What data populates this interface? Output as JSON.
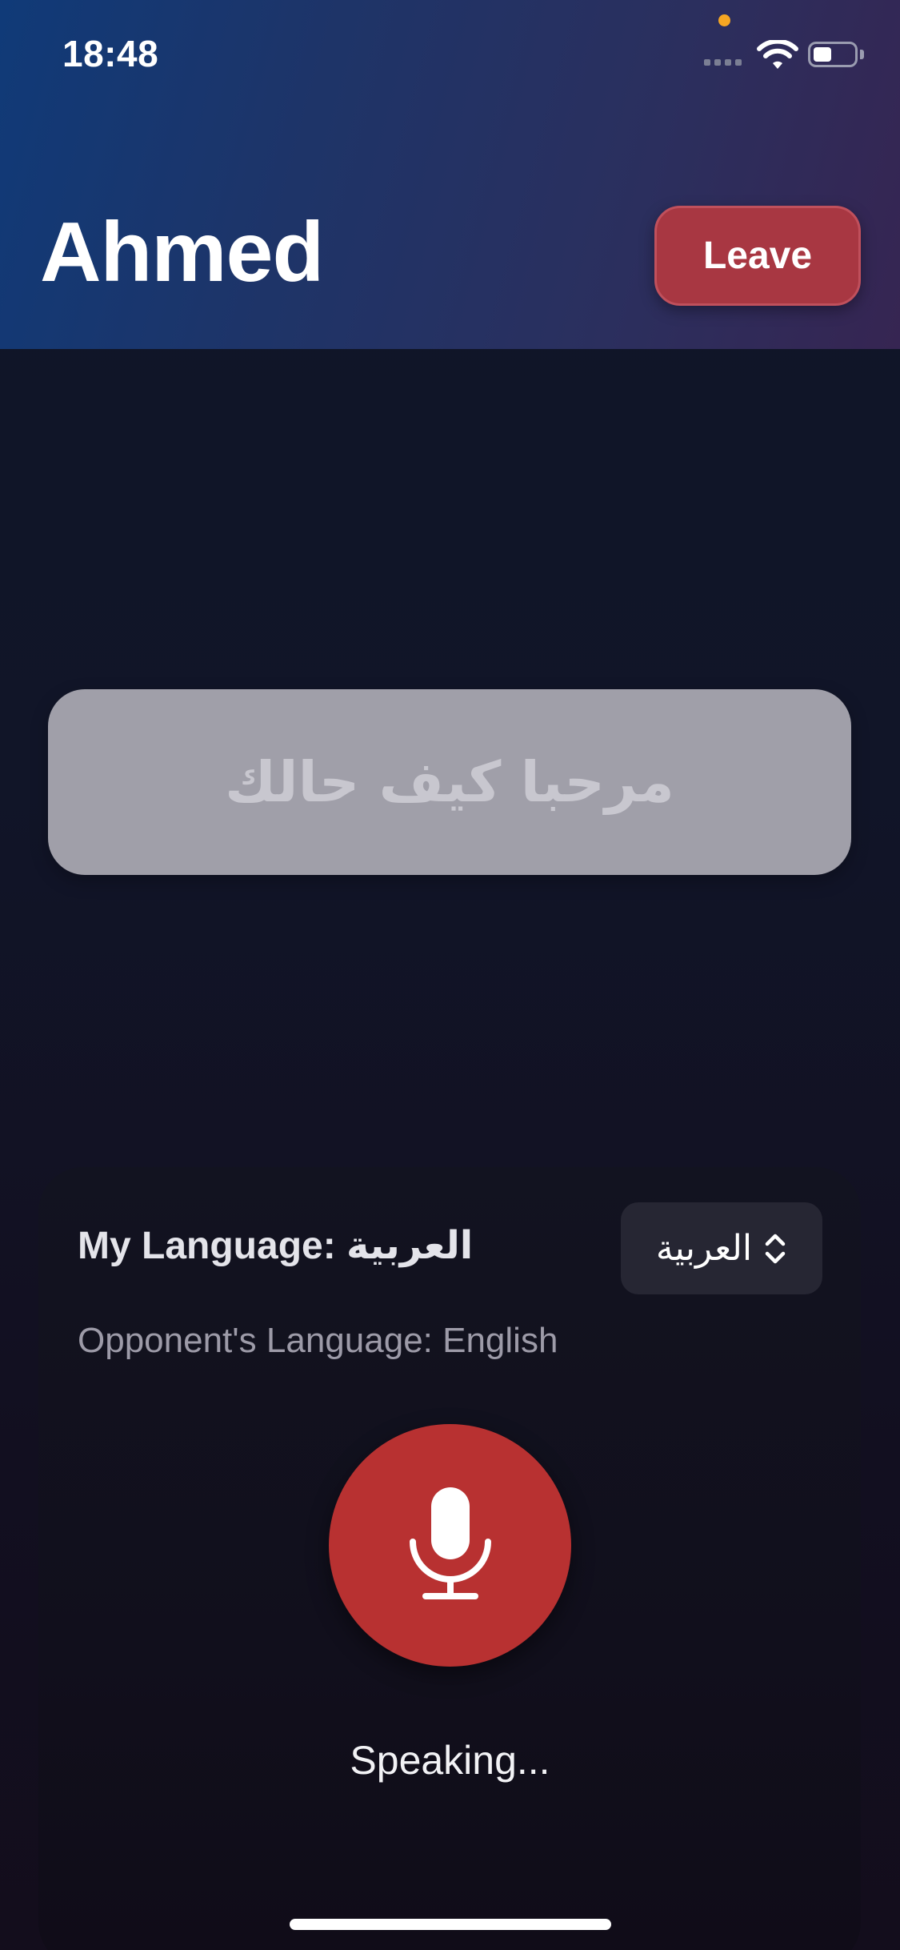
{
  "status_bar": {
    "time": "18:48"
  },
  "header": {
    "title": "Ahmed",
    "leave_label": "Leave"
  },
  "message": {
    "text": "مرحبا كيف حالك"
  },
  "controls": {
    "my_language_label": "My Language: العربية",
    "language_picker_value": "العربية",
    "opponent_language_label": "Opponent's Language: English",
    "status_text": "Speaking..."
  },
  "colors": {
    "accent_red": "#b83131",
    "leave_red": "#a83742",
    "header_start": "#103a78",
    "header_end": "#362552",
    "bubble": "#a09fa9"
  },
  "icons": {
    "mic": "mic-icon",
    "picker": "chevron-up-down-icon",
    "wifi": "wifi-icon",
    "battery": "battery-icon"
  }
}
